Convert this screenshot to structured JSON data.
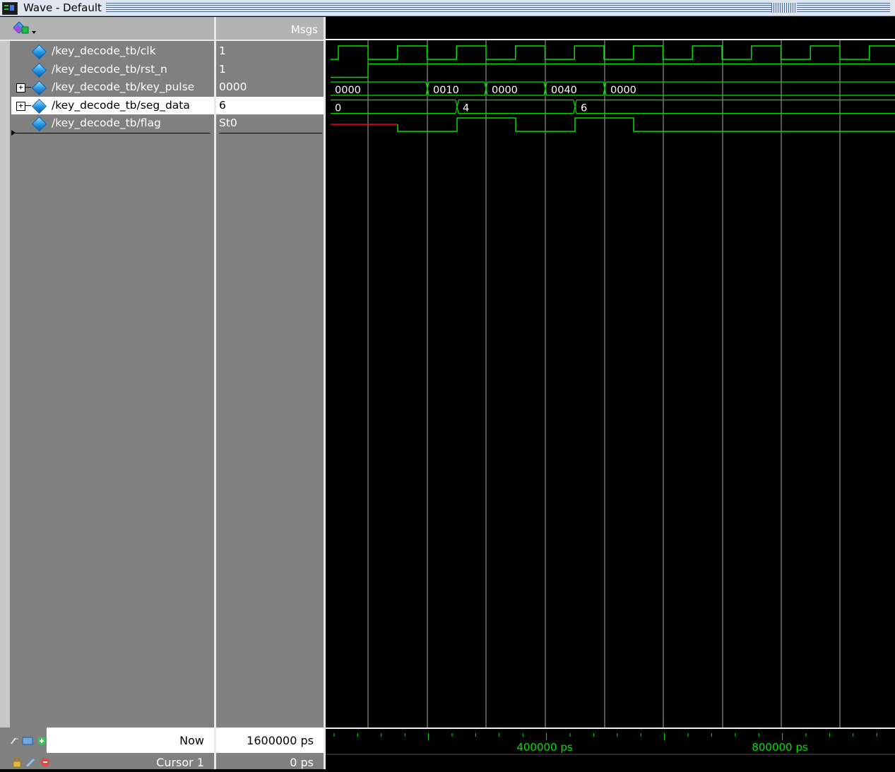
{
  "window": {
    "title": "Wave - Default"
  },
  "header": {
    "msgs_label": "Msgs"
  },
  "signals": [
    {
      "name": "/key_decode_tb/clk",
      "value": "1",
      "expandable": false,
      "selected": false
    },
    {
      "name": "/key_decode_tb/rst_n",
      "value": "1",
      "expandable": false,
      "selected": false
    },
    {
      "name": "/key_decode_tb/key_pulse",
      "value": "0000",
      "expandable": true,
      "selected": false
    },
    {
      "name": "/key_decode_tb/seg_data",
      "value": "6",
      "expandable": true,
      "selected": true
    },
    {
      "name": "/key_decode_tb/flag",
      "value": "St0",
      "expandable": false,
      "selected": false
    }
  ],
  "bus_values": {
    "key_pulse": [
      "0000",
      "0010",
      "0000",
      "0040",
      "0000"
    ],
    "seg_data": [
      "0",
      "4",
      "6"
    ]
  },
  "status": {
    "now_label": "Now",
    "now_value": "1600000 ps",
    "cursor_label": "Cursor 1",
    "cursor_value": "0 ps"
  },
  "timeline": {
    "labels": [
      "400000 ps",
      "800000 ps"
    ]
  },
  "colors": {
    "wave": "#00e000",
    "undefined": "#ff0000",
    "grid": "#d8d8d8",
    "background": "#000000",
    "pane": "#808080"
  },
  "icons": [
    "wave-app-icon",
    "add-wave-icon",
    "zoom-icon",
    "lock-icon",
    "edit-icon",
    "delete-icon"
  ]
}
